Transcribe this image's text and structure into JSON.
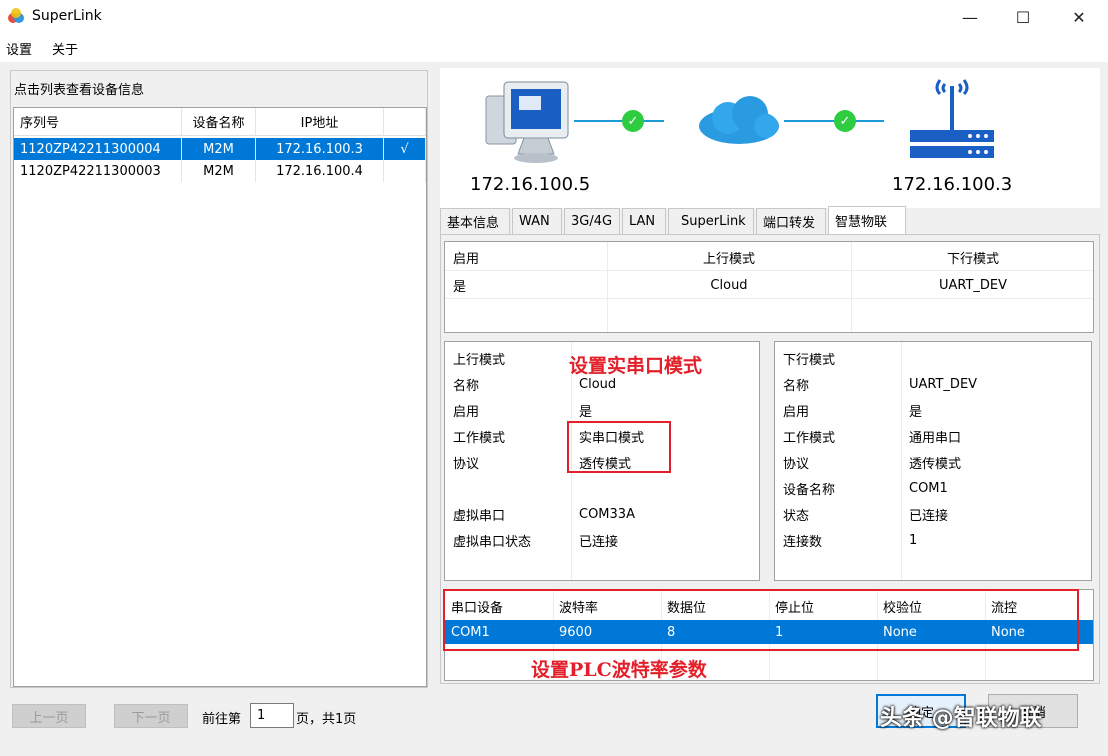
{
  "window": {
    "title": "SuperLink",
    "min_symbol": "—",
    "max_symbol": "☐",
    "close_symbol": "✕"
  },
  "menu": [
    "设置",
    "关于"
  ],
  "left": {
    "group_title": "点击列表查看设备信息",
    "columns": [
      "序列号",
      "设备名称",
      "IP地址",
      ""
    ],
    "rows": [
      {
        "serial": "1120ZP42211300004",
        "name": "M2M",
        "ip": "172.16.100.3",
        "check": "√",
        "selected": true
      },
      {
        "serial": "1120ZP42211300003",
        "name": "M2M",
        "ip": "172.16.100.4",
        "check": "",
        "selected": false
      }
    ],
    "pager": {
      "prev": "上一页",
      "next": "下一页",
      "goto_prefix": "前往第",
      "page": "1",
      "goto_suffix": "页，共1页"
    }
  },
  "topology": {
    "local_ip": "172.16.100.5",
    "remote_ip": "172.16.100.3"
  },
  "tabs": [
    "基本信息",
    "WAN",
    "3G/4G",
    "LAN",
    "SuperLink",
    "端口转发",
    "智慧物联"
  ],
  "active_tab": 6,
  "mode_table": {
    "headers": [
      "启用",
      "上行模式",
      "下行模式"
    ],
    "row": [
      "是",
      "Cloud",
      "UART_DEV"
    ]
  },
  "uplink": {
    "rows": [
      [
        "上行模式",
        ""
      ],
      [
        "名称",
        "Cloud"
      ],
      [
        "启用",
        "是"
      ],
      [
        "工作模式",
        "实串口模式"
      ],
      [
        "协议",
        "透传模式"
      ],
      [
        "",
        ""
      ],
      [
        "虚拟串口",
        "COM33A"
      ],
      [
        "虚拟串口状态",
        "已连接"
      ]
    ]
  },
  "downlink": {
    "rows": [
      [
        "下行模式",
        ""
      ],
      [
        "名称",
        "UART_DEV"
      ],
      [
        "启用",
        "是"
      ],
      [
        "工作模式",
        "通用串口"
      ],
      [
        "协议",
        "透传模式"
      ],
      [
        "设备名称",
        "COM1"
      ],
      [
        "状态",
        "已连接"
      ],
      [
        "连接数",
        "1"
      ]
    ]
  },
  "serial_table": {
    "headers": [
      "串口设备",
      "波特率",
      "数据位",
      "停止位",
      "校验位",
      "流控"
    ],
    "row": [
      "COM1",
      "9600",
      "8",
      "1",
      "None",
      "None"
    ]
  },
  "annotations": {
    "set_mode": "设置实串口模式",
    "set_baud": "设置PLC波特率参数"
  },
  "buttons": {
    "ok": "确定",
    "cancel": "取消"
  },
  "watermark": "头条 @智联物联",
  "colors": {
    "selection": "#0078d7",
    "annotation": "#e3202a",
    "link": "#1e9ad6",
    "ok_dot": "#2ecc40"
  }
}
